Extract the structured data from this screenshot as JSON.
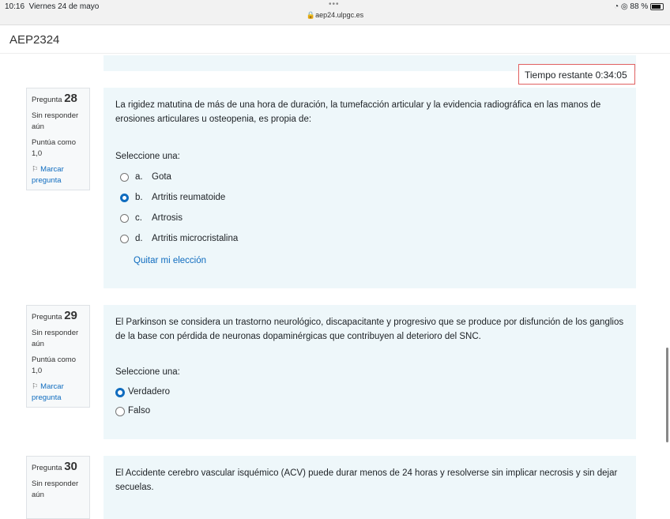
{
  "status": {
    "time": "10:16",
    "date": "Viernes 24 de mayo",
    "url": "aep24.ulpgc.es",
    "battery": "88 %",
    "battery_level": 0.88
  },
  "header": {
    "title": "AEP2324"
  },
  "timer": "Tiempo restante 0:34:05",
  "labels": {
    "pregunta": "Pregunta",
    "status": "Sin responder aún",
    "score": "Puntúa como 1,0",
    "flag": "Marcar pregunta",
    "select": "Seleccione una:",
    "clear": "Quitar mi elección"
  },
  "questions": [
    {
      "number": "28",
      "text": "La rigidez matutina de más de una hora de duración, la tumefacción articular y la evidencia radiográfica en las manos de erosiones articulares u osteopenia, es propia de:",
      "options": [
        {
          "letter": "a.",
          "label": "Gota",
          "selected": false
        },
        {
          "letter": "b.",
          "label": "Artritis reumatoide",
          "selected": true
        },
        {
          "letter": "c.",
          "label": "Artrosis",
          "selected": false
        },
        {
          "letter": "d.",
          "label": "Artritis microcristalina",
          "selected": false
        }
      ]
    },
    {
      "number": "29",
      "text": "El Parkinson se considera un trastorno neurológico, discapacitante y progresivo que se produce por disfunción de los ganglios de la base con pérdida de neuronas dopaminérgicas que contribuyen al deterioro del SNC.",
      "options": [
        {
          "label": "Verdadero",
          "selected": true
        },
        {
          "label": "Falso",
          "selected": false
        }
      ]
    },
    {
      "number": "30",
      "text": "El Accidente cerebro vascular isquémico (ACV) puede durar menos de 24 horas y resolverse sin implicar necrosis y sin dejar secuelas."
    }
  ]
}
